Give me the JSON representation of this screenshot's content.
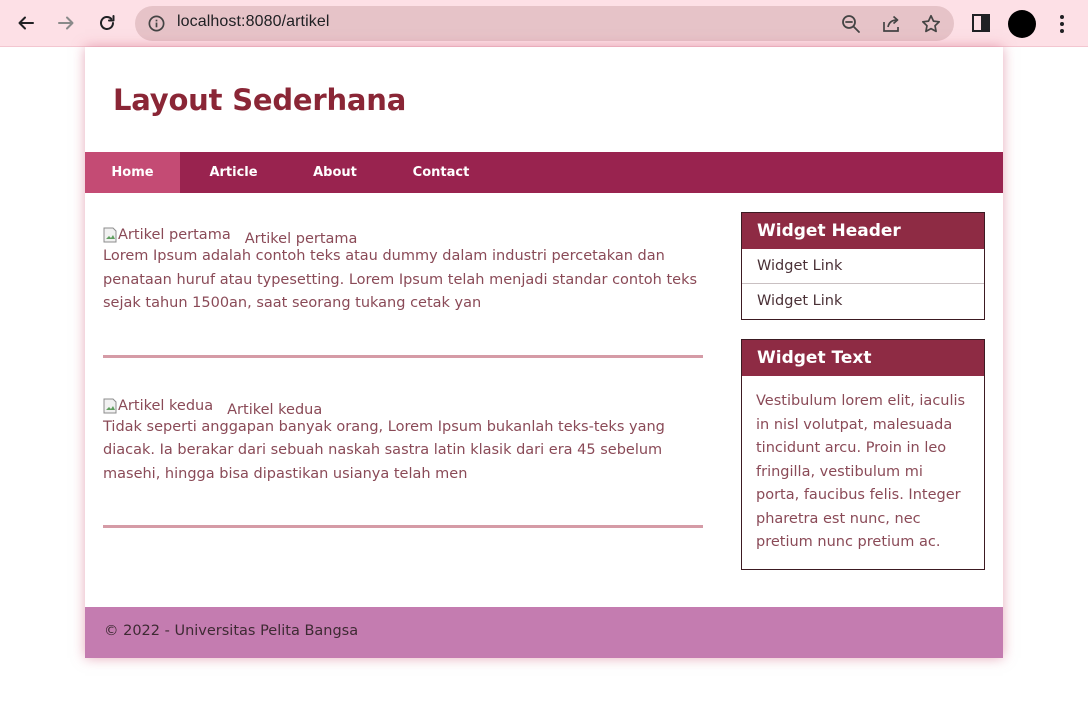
{
  "browser": {
    "url": "localhost:8080/artikel",
    "icons": [
      "back-icon",
      "forward-icon",
      "reload-icon",
      "info-icon",
      "zoom-out-icon",
      "share-icon",
      "star-icon",
      "side-panel-icon",
      "profile-avatar",
      "more-icon"
    ]
  },
  "site": {
    "title": "Layout Sederhana"
  },
  "menu": {
    "items": [
      {
        "label": "Home"
      },
      {
        "label": "Article"
      },
      {
        "label": "About"
      },
      {
        "label": "Contact"
      }
    ]
  },
  "articles": [
    {
      "image_alt": "Artikel pertama",
      "title": "Artikel pertama",
      "body": "Lorem Ipsum adalah contoh teks atau dummy dalam industri percetakan dan penataan huruf atau typesetting. Lorem Ipsum telah menjadi standar contoh teks sejak tahun 1500an, saat seorang tukang cetak yan"
    },
    {
      "image_alt": "Artikel kedua",
      "title": "Artikel kedua",
      "body": "Tidak seperti anggapan banyak orang, Lorem Ipsum bukanlah teks-teks yang diacak. Ia berakar dari sebuah naskah sastra latin klasik dari era 45 sebelum masehi, hingga bisa dipastikan usianya telah men"
    }
  ],
  "sidebar": {
    "widget_header": {
      "title": "Widget Header",
      "links": [
        "Widget Link",
        "Widget Link"
      ]
    },
    "widget_text": {
      "title": "Widget Text",
      "body": "Vestibulum lorem elit, iaculis in nisl volutpat, malesuada tincidunt arcu. Proin in leo fringilla, vestibulum mi porta, faucibus felis. Integer pharetra est nunc, nec pretium nunc pretium ac."
    }
  },
  "footer": {
    "text": "© 2022 - Universitas Pelita Bangsa"
  },
  "colors": {
    "menu_bg": "#99234f",
    "menu_active": "#c44b74",
    "title": "#8a2636",
    "widget_head": "#8e2b44",
    "footer_bg": "#c47cb0"
  }
}
